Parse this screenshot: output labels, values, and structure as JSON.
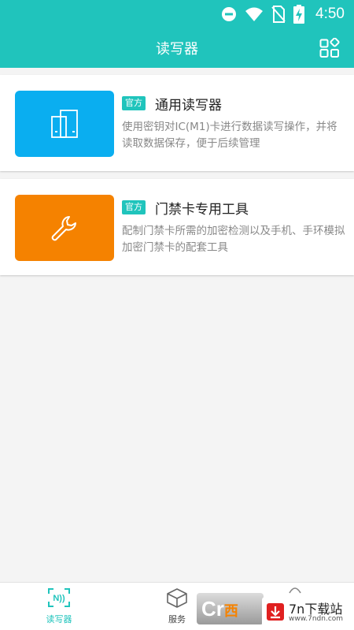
{
  "status_bar": {
    "time": "4:50"
  },
  "app_bar": {
    "title": "读写器",
    "action_icon": "apps-grid-icon"
  },
  "tools": [
    {
      "badge": "官方",
      "name": "通用读写器",
      "description": "使用密钥对IC(M1)卡进行数据读写操作，并将读取数据保存，便于后续管理",
      "icon": "card-reader-icon",
      "color": "#0aaef0"
    },
    {
      "badge": "官方",
      "name": "门禁卡专用工具",
      "description": "配制门禁卡所需的加密检测以及手机、手环模拟加密门禁卡的配套工具",
      "icon": "wrench-icon",
      "color": "#f58200"
    }
  ],
  "bottom_nav": [
    {
      "label": "读写器",
      "icon": "nfc-reader-icon",
      "active": true,
      "color": "#20c4bc"
    },
    {
      "label": "服务",
      "icon": "box-icon",
      "active": false,
      "color": "#444444"
    }
  ],
  "watermark": {
    "site_name": "7n下载站",
    "site_url": "www.7ndn.com"
  }
}
